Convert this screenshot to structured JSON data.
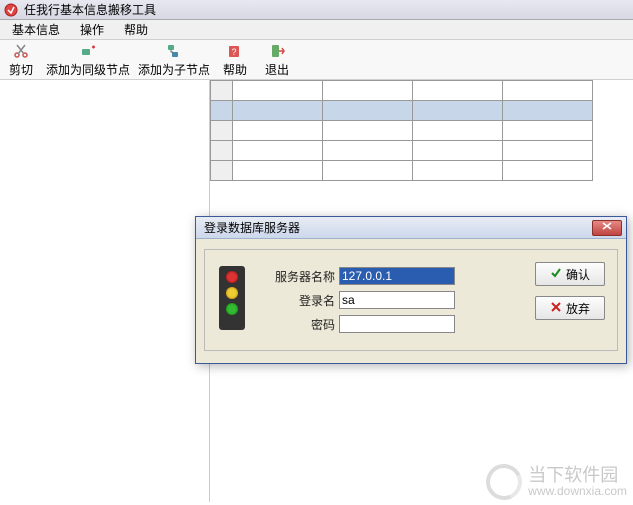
{
  "window": {
    "title": "任我行基本信息搬移工具"
  },
  "menubar": {
    "items": [
      "基本信息",
      "操作",
      "帮助"
    ]
  },
  "toolbar": {
    "items": [
      {
        "label": "剪切",
        "icon": "scissors-icon"
      },
      {
        "label": "添加为同级节点",
        "icon": "add-sibling-icon"
      },
      {
        "label": "添加为子节点",
        "icon": "add-child-icon"
      },
      {
        "label": "帮助",
        "icon": "help-icon"
      },
      {
        "label": "退出",
        "icon": "exit-icon"
      }
    ]
  },
  "dialog": {
    "title": "登录数据库服务器",
    "fields": {
      "server_label": "服务器名称",
      "server_value": "127.0.0.1",
      "login_label": "登录名",
      "login_value": "sa",
      "password_label": "密码",
      "password_value": ""
    },
    "buttons": {
      "ok": "确认",
      "cancel": "放弃"
    }
  },
  "watermark": {
    "line1": "当下软件园",
    "line2": "www.downxia.com"
  }
}
